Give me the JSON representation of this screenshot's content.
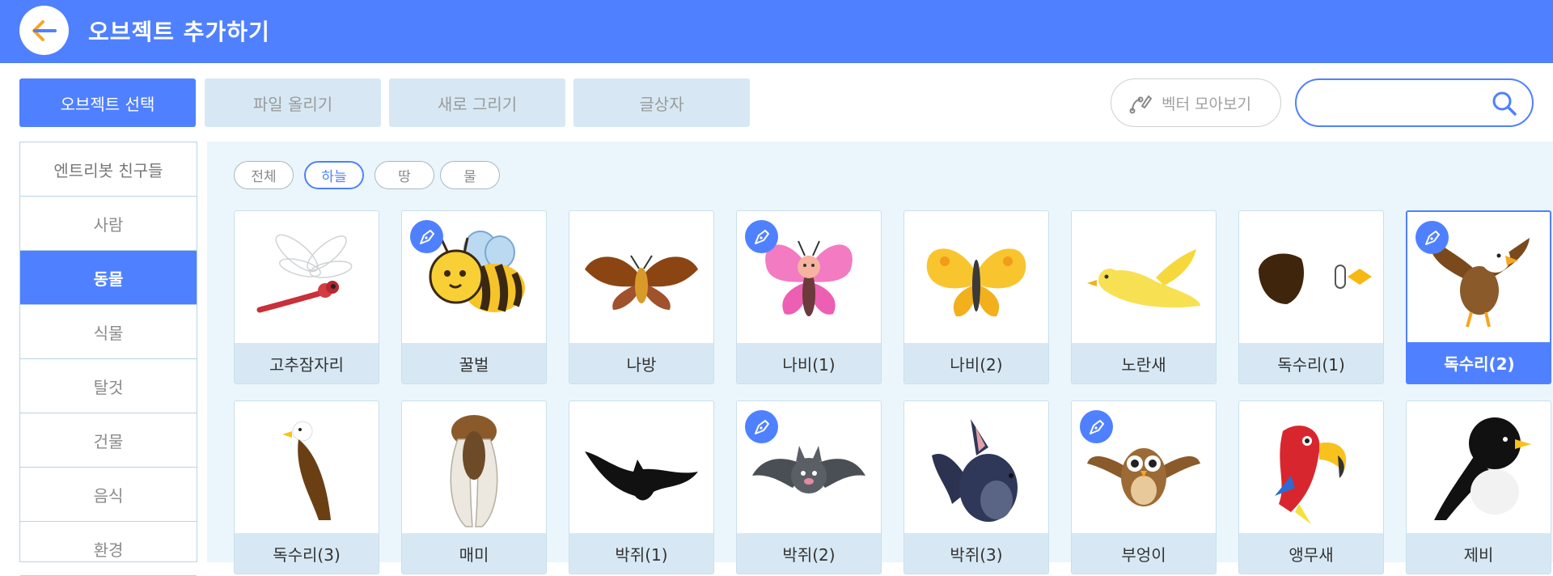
{
  "header": {
    "title": "오브젝트 추가하기",
    "back_icon": "arrow-left-icon"
  },
  "tabs": [
    {
      "label": "오브젝트 선택",
      "active": true
    },
    {
      "label": "파일 올리기",
      "active": false
    },
    {
      "label": "새로 그리기",
      "active": false
    },
    {
      "label": "글상자",
      "active": false
    }
  ],
  "vector_button": {
    "label": "벡터 모아보기",
    "icon": "vector-pen-icon"
  },
  "search": {
    "value": "",
    "placeholder": "",
    "icon": "search-icon"
  },
  "sidebar": {
    "items": [
      {
        "label": "엔트리봇 친구들",
        "active": false
      },
      {
        "label": "사람",
        "active": false
      },
      {
        "label": "동물",
        "active": true
      },
      {
        "label": "식물",
        "active": false
      },
      {
        "label": "탈것",
        "active": false
      },
      {
        "label": "건물",
        "active": false
      },
      {
        "label": "음식",
        "active": false
      },
      {
        "label": "환경",
        "active": false
      }
    ]
  },
  "filters": [
    {
      "label": "전체",
      "active": false
    },
    {
      "label": "하늘",
      "active": true
    },
    {
      "label": "땅",
      "active": false
    },
    {
      "label": "물",
      "active": false
    }
  ],
  "objects": [
    {
      "name": "고추잠자리",
      "vector": false,
      "selected": false,
      "icon": "dragonfly"
    },
    {
      "name": "꿀벌",
      "vector": true,
      "selected": false,
      "icon": "bee"
    },
    {
      "name": "나방",
      "vector": false,
      "selected": false,
      "icon": "moth"
    },
    {
      "name": "나비(1)",
      "vector": true,
      "selected": false,
      "icon": "pink-butterfly"
    },
    {
      "name": "나비(2)",
      "vector": false,
      "selected": false,
      "icon": "yellow-butterfly"
    },
    {
      "name": "노란새",
      "vector": false,
      "selected": false,
      "icon": "yellow-bird"
    },
    {
      "name": "독수리(1)",
      "vector": false,
      "selected": false,
      "icon": "eagle-parts"
    },
    {
      "name": "독수리(2)",
      "vector": true,
      "selected": true,
      "icon": "eagle-flying"
    },
    {
      "name": "독수리(3)",
      "vector": false,
      "selected": false,
      "icon": "eagle-perched"
    },
    {
      "name": "매미",
      "vector": false,
      "selected": false,
      "icon": "cicada"
    },
    {
      "name": "박쥐(1)",
      "vector": false,
      "selected": false,
      "icon": "black-bat"
    },
    {
      "name": "박쥐(2)",
      "vector": true,
      "selected": false,
      "icon": "gray-bat"
    },
    {
      "name": "박쥐(3)",
      "vector": false,
      "selected": false,
      "icon": "navy-bat"
    },
    {
      "name": "부엉이",
      "vector": true,
      "selected": false,
      "icon": "owl"
    },
    {
      "name": "앵무새",
      "vector": false,
      "selected": false,
      "icon": "parrot"
    },
    {
      "name": "제비",
      "vector": false,
      "selected": false,
      "icon": "swallow"
    }
  ],
  "colors": {
    "accent": "#4f80ff",
    "panel": "#ebf6fc",
    "label_bg": "#d7e8f4",
    "back_arrow": "#f5a623"
  }
}
